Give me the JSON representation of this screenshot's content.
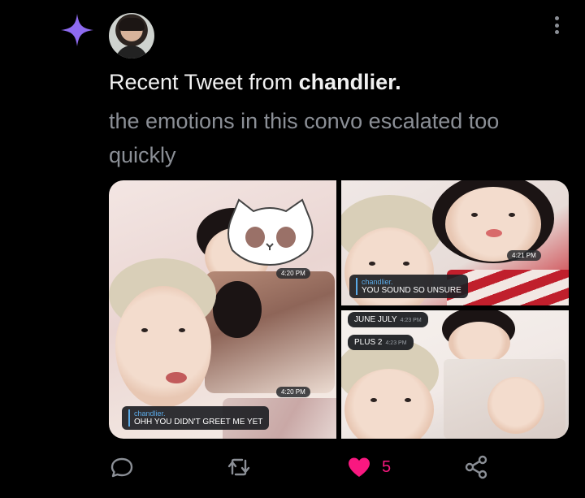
{
  "tweet": {
    "headline_prefix": "Recent Tweet from ",
    "author": "chandlier.",
    "text": "the emotions in this convo escalated too quickly"
  },
  "media": {
    "left_panel": {
      "timestamp_top": "4:20 PM",
      "timestamp_bottom": "4:20 PM",
      "reply_name": "chandlier.",
      "reply_text": "OHH YOU DIDN'T GREET ME YET"
    },
    "top_right_panel": {
      "timestamp": "4:21 PM",
      "reply_name": "chandlier.",
      "reply_text": "YOU SOUND SO UNSURE"
    },
    "bottom_right_panel": {
      "msg1": "JUNE JULY",
      "msg1_time": "4:23 PM",
      "msg2": "PLUS 2",
      "msg2_time": "4:23 PM"
    }
  },
  "actions": {
    "like_count": "5"
  },
  "colors": {
    "background": "#000000",
    "sparkle": "#8e6bf0",
    "like": "#f91880",
    "muted_text": "#8b8f96"
  },
  "icons": [
    "sparkle-icon",
    "more-vertical-icon",
    "reply-icon",
    "retweet-icon",
    "heart-icon",
    "share-icon"
  ]
}
